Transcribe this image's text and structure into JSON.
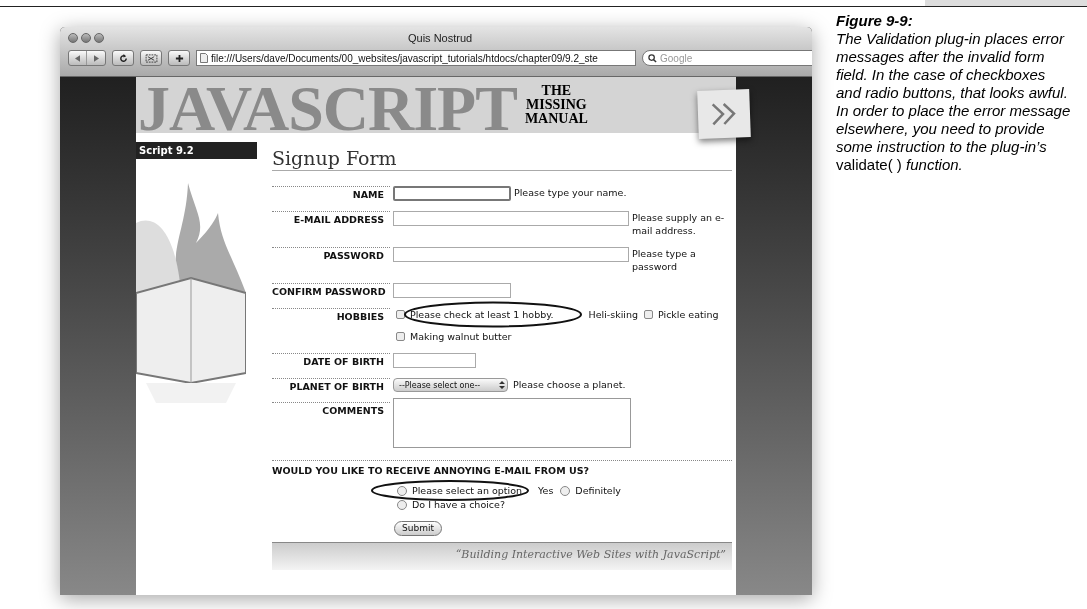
{
  "caption": {
    "title": "Figure 9-9:",
    "text": "*The Validation plug-in places error messages after the invalid form field. In the case of checkboxes and radio buttons, that looks awful. In order to place the error message elsewhere, you need to provide some instruction to the plug-in’s* validate( ) *function.*"
  },
  "browser": {
    "title": "Quis Nostrud",
    "url": "file:///Users/dave/Documents/00_websites/javascript_tutorials/htdocs/chapter09/9.2_ste",
    "search_placeholder": "Google"
  },
  "banner": {
    "wordmark": "JAVASCRIPT",
    "logo_lines": [
      "THE",
      "MISSING",
      "MANUAL"
    ]
  },
  "sidebar": {
    "label": "Script 9.2"
  },
  "form": {
    "heading": "Signup Form",
    "fields": [
      {
        "kind": "short_text",
        "label": "NAME",
        "error": "Please type your name.",
        "focused": true
      },
      {
        "kind": "long_text",
        "label": "E-MAIL ADDRESS",
        "error": "Please supply an e-mail address.",
        "focused": false
      },
      {
        "kind": "long_text",
        "label": "PASSWORD",
        "error": "Please type a password",
        "focused": false
      },
      {
        "kind": "short_text",
        "label": "CONFIRM PASSWORD",
        "focused": false
      },
      {
        "kind": "checkboxes",
        "label": "HOBBIES",
        "error": "Please check at least 1 hobby.",
        "options": [
          {
            "label": "Heli-skiing",
            "checked": false
          },
          {
            "label": "Pickle eating",
            "checked": false
          },
          {
            "label": "Making walnut butter",
            "checked": false
          }
        ]
      },
      {
        "kind": "date",
        "label": "DATE OF BIRTH",
        "focused": false
      },
      {
        "kind": "select",
        "label": "PLANET OF BIRTH",
        "value": "--Please select one--",
        "error": "Please choose a planet."
      },
      {
        "kind": "textarea",
        "label": "COMMENTS"
      }
    ],
    "question": {
      "text": "WOULD YOU LIKE TO RECEIVE ANNOYING E-MAIL FROM US?",
      "error": "Please select an option",
      "options": [
        {
          "label": "Yes",
          "selected": false
        },
        {
          "label": "Definitely",
          "selected": false
        },
        {
          "label": "Do I have a choice?",
          "selected": false
        }
      ]
    },
    "submit": "Submit"
  },
  "footer": {
    "quote": "“Building Interactive Web Sites with JavaScript”"
  }
}
